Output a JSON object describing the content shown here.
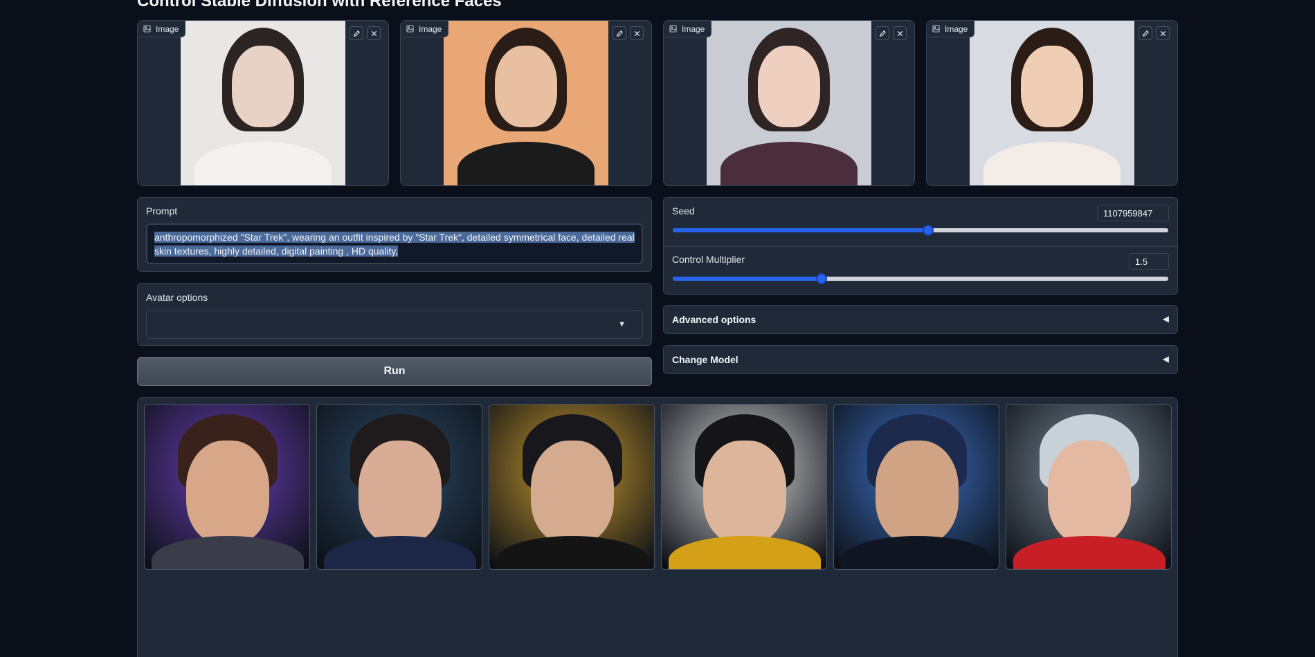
{
  "page": {
    "title": "Control Stable Diffusion with Reference Faces"
  },
  "reference_images": [
    {
      "label": "Image",
      "skin": "#e8d2c6",
      "hair": "#2b2422",
      "bg": "#e9e7e6",
      "shirt": "#f4f2ef"
    },
    {
      "label": "Image",
      "skin": "#e8bfa0",
      "hair": "#2a1d18",
      "bg": "#e8a774",
      "shirt": "#1b1b1b"
    },
    {
      "label": "Image",
      "skin": "#efcfc0",
      "hair": "#2f2524",
      "bg": "#c9cdd3",
      "shirt": "#4a2e3c"
    },
    {
      "label": "Image",
      "skin": "#f0cdb5",
      "hair": "#2b1c16",
      "bg": "#d8dce2",
      "shirt": "#f4ece6"
    }
  ],
  "prompt": {
    "label": "Prompt",
    "value": "anthropomorphized \"Star Trek\", wearing an outfit inspired by \"Star Trek\", detailed symmetrical face, detailed real skin textures, highly detailed, digital painting , HD quality,"
  },
  "avatar_options": {
    "label": "Avatar options",
    "selected": ""
  },
  "run_button": {
    "label": "Run"
  },
  "seed": {
    "label": "Seed",
    "value": "1107959847",
    "fraction": 0.516
  },
  "control_multiplier": {
    "label": "Control Multiplier",
    "value": "1.5",
    "fraction": 0.3
  },
  "advanced_options": {
    "label": "Advanced options",
    "arrow": "◀"
  },
  "change_model": {
    "label": "Change Model",
    "arrow": "◀"
  },
  "gallery": [
    {
      "skin": "#d8a78a",
      "hair": "#3a221c",
      "bg": "#6a3fb8",
      "uniform": "#3a3c4a"
    },
    {
      "skin": "#d9ad95",
      "hair": "#1f1a1c",
      "bg": "#2d4a68",
      "uniform": "#1c2747"
    },
    {
      "skin": "#d4ab8e",
      "hair": "#17171c",
      "bg": "#c99a2e",
      "uniform": "#141414"
    },
    {
      "skin": "#dcb59b",
      "hair": "#151518",
      "bg": "#d8d8da",
      "uniform": "#d4a018"
    },
    {
      "skin": "#cfa384",
      "hair": "#1b2a4d",
      "bg": "#3d72c8",
      "uniform": "#101522"
    },
    {
      "skin": "#e3b9a1",
      "hair": "#c8d0d8",
      "bg": "#7c8a98",
      "uniform": "#c81f27"
    }
  ],
  "icons": {
    "image_tag": "image-icon",
    "edit": "pencil-icon",
    "clear": "close-icon",
    "dropdown": "caret-down-icon",
    "accordion": "triangle-left-icon"
  },
  "colors": {
    "background": "#0b0f19",
    "panel": "#1f2937",
    "border": "#374151",
    "accent": "#2563eb",
    "selection": "#4a6a9a"
  }
}
